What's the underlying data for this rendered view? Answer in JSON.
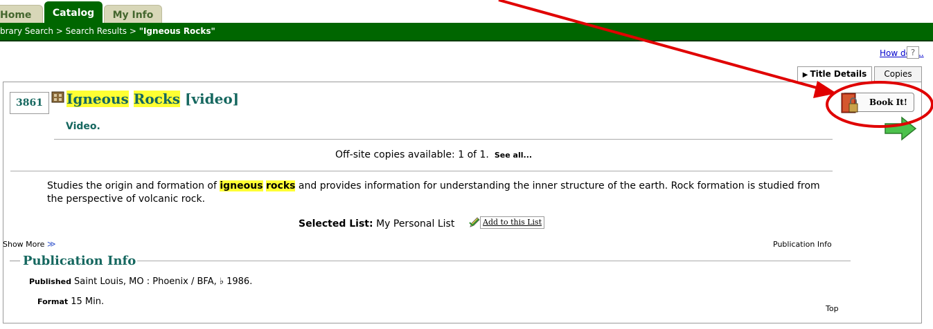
{
  "tabs": [
    {
      "label": "Home"
    },
    {
      "label": "Catalog"
    },
    {
      "label": "My Info"
    }
  ],
  "breadcrumb": {
    "prefix": "brary Search > Search Results > ",
    "current": "\"Igneous Rocks\""
  },
  "help": {
    "link": "How do I...",
    "icon_text": "?"
  },
  "record_tabs": {
    "details": "Title Details",
    "copies": "Copies"
  },
  "record": {
    "number": "3861",
    "title_word1": "Igneous",
    "title_word2": "Rocks",
    "title_suffix": "[video]",
    "subtitle": "Video.",
    "offsite": "Off-site copies available: 1 of 1.",
    "see_all": "See all...",
    "summary_pre": "Studies the origin and formation of ",
    "summary_hl1": "igneous",
    "summary_hl2": "rocks",
    "summary_post": " and provides information for understanding the inner structure of the earth. Rock formation is studied from the perspective of volcanic rock."
  },
  "selected_list": {
    "label": "Selected List:",
    "value": "My Personal List",
    "add_button": "Add to this List"
  },
  "book_it": "Book It!",
  "show_more": "Show More",
  "publication_info_link": "Publication Info",
  "publication": {
    "heading": "Publication Info",
    "published_label": "Published",
    "published_value": "Saint Louis, MO : Phoenix / BFA, ♭ 1986.",
    "format_label": "Format",
    "format_value": "15 Min."
  },
  "top_link": "Top",
  "colors": {
    "green_bar": "#006600",
    "teal_text": "#15675f",
    "highlight": "#ffff33",
    "annotation_red": "#e00000"
  }
}
